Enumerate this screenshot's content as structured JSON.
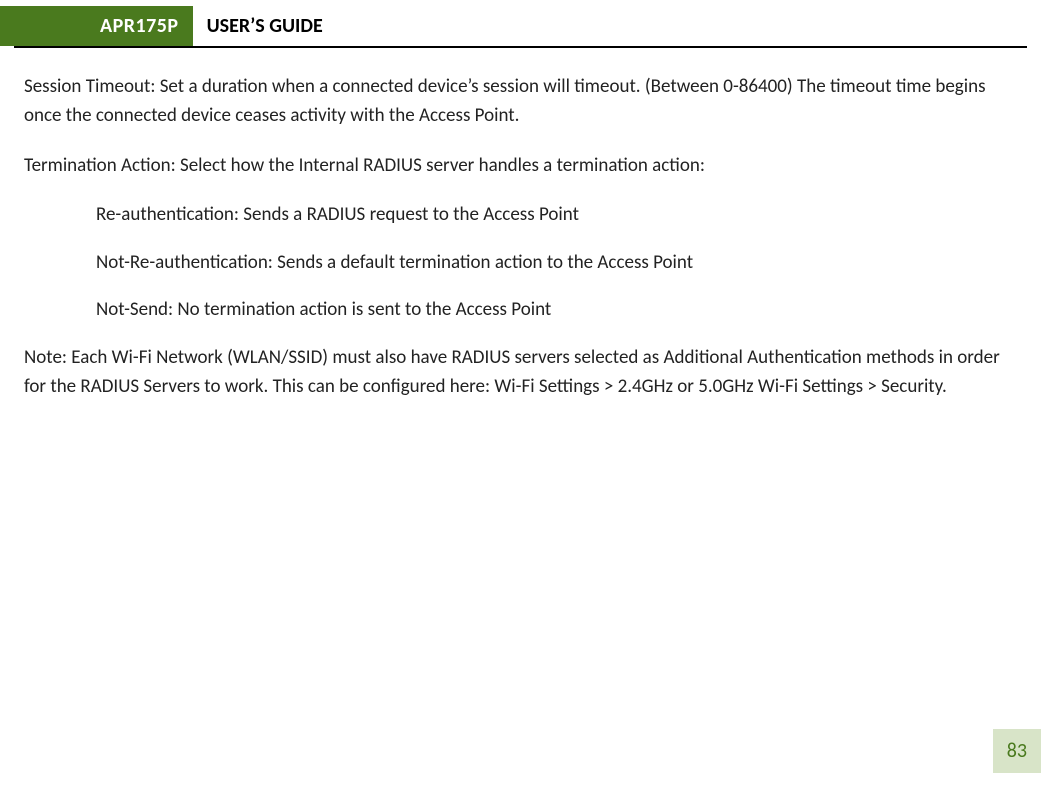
{
  "header": {
    "badge": "APR175P",
    "title": "USER’S GUIDE"
  },
  "body": {
    "session_timeout": "Session Timeout: Set a duration when a connected device’s session will timeout. (Between 0-86400) The timeout time begins once the connected device ceases activity with the Access Point.",
    "termination_action_intro": "Termination Action: Select how the Internal RADIUS server handles a termination action:",
    "termination_options": {
      "reauth": "Re-authentication: Sends a RADIUS request to the Access Point",
      "not_reauth": "Not-Re-authentication: Sends a default termination action to the Access Point",
      "not_send": "Not-Send: No termination action is sent to the Access Point"
    },
    "note": "Note: Each Wi-Fi Network (WLAN/SSID) must also have RADIUS servers selected as Additional Authentication methods in order for the RADIUS Servers to work.  This can be configured here: Wi-Fi Settings > 2.4GHz or 5.0GHz Wi-Fi Settings > Security."
  },
  "page_number": "83",
  "colors": {
    "brand_green": "#4a7a1e",
    "page_badge_bg": "#d8e4c8"
  }
}
